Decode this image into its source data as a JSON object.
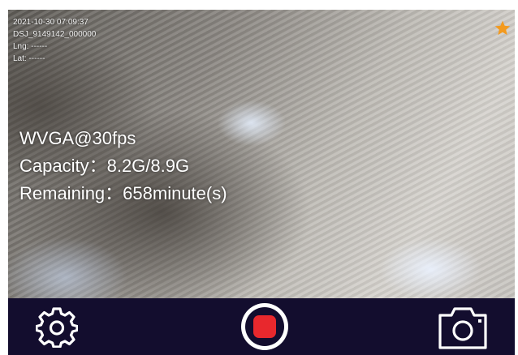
{
  "overlay": {
    "datetime": "2021-10-30 07:09:37",
    "device_id": "DSJ_9149142_000000",
    "longitude": "Lng: ------",
    "latitude": "Lat: ------"
  },
  "status": {
    "resolution": "WVGA@30fps",
    "capacity": "Capacity：8.2G/8.9G",
    "remaining": "Remaining：658minute(s)"
  },
  "toolbar": {
    "settings_icon": "gear-icon",
    "record_icon": "record-icon",
    "camera_icon": "camera-icon"
  },
  "colors": {
    "toolbar_bg": "#130d2e",
    "record_red": "#e8282d",
    "star_orange": "#f39a1e",
    "icon_white": "#ffffff"
  }
}
